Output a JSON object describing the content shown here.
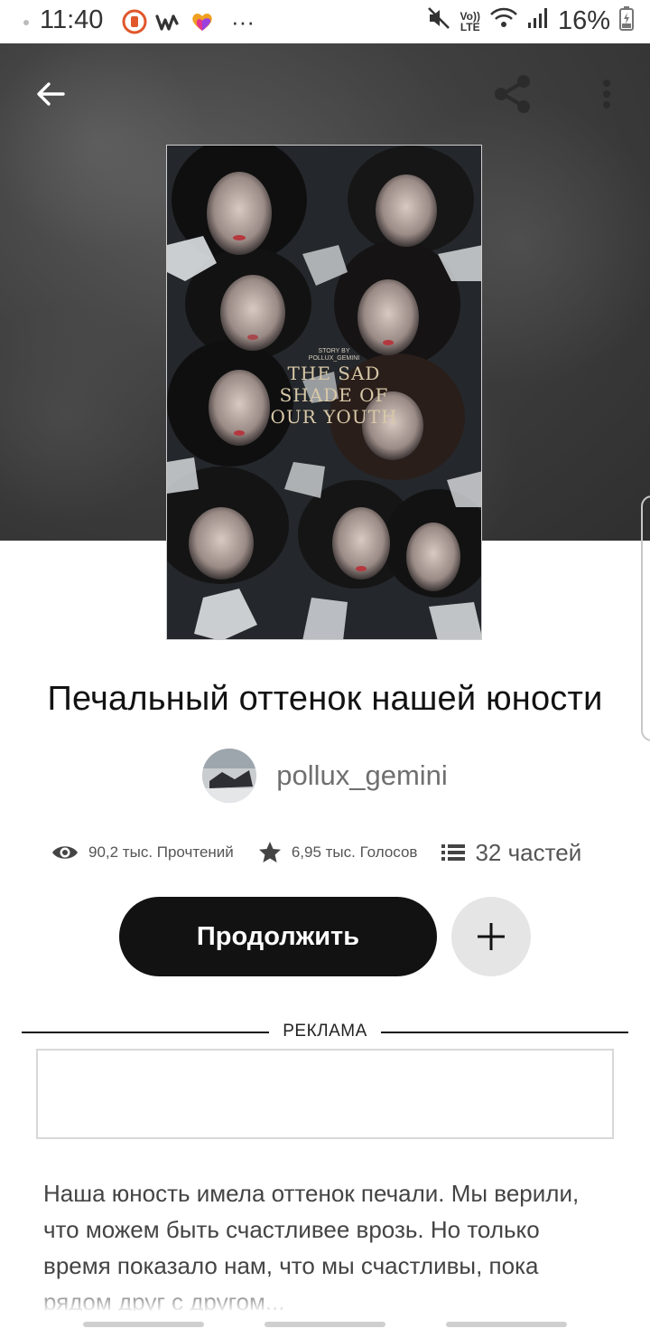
{
  "status_bar": {
    "time": "11:40",
    "battery": "16%",
    "net_label_top": "Vo))",
    "net_label_bottom": "LTE",
    "more": "···"
  },
  "header": {
    "back_icon": "arrow-left-icon",
    "share_icon": "share-icon",
    "menu_icon": "more-vert-icon"
  },
  "cover": {
    "credit": "STORY BY POLLUX_GEMINI",
    "line1": "THE SAD",
    "line2": "SHADE OF",
    "line3": "OUR YOUTH"
  },
  "story": {
    "title": "Печальный оттенок нашей юности",
    "author": "pollux_gemini",
    "reads": "90,2 тыс. Прочтений",
    "votes": "6,95 тыс. Голосов",
    "parts": "32 частей",
    "continue_label": "Продолжить",
    "ad_label": "РЕКЛАМА",
    "description": "Наша юность имела оттенок печали. Мы верили, что можем быть счастливее врозь. Но только время показало нам, что мы счастливы, пока рядом друг с другом..."
  },
  "colors": {
    "primary_button": "#121212",
    "secondary_button": "#e5e5e5",
    "text_muted": "#6f6f6f"
  }
}
